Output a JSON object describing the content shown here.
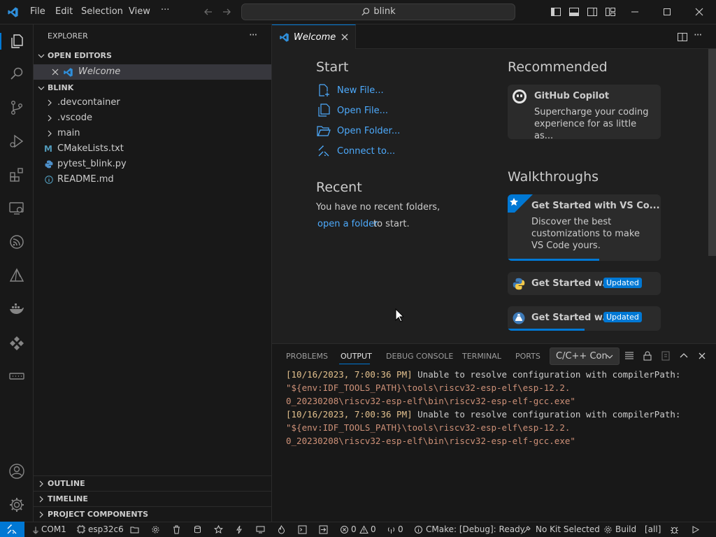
{
  "titlebar": {
    "menus": [
      "File",
      "Edit",
      "Selection",
      "View",
      "···"
    ],
    "search_text": "blink"
  },
  "sidebar": {
    "title": "EXPLORER",
    "open_editors": {
      "label": "OPEN EDITORS",
      "items": [
        {
          "name": "Welcome"
        }
      ]
    },
    "folder": {
      "label": "BLINK",
      "items": [
        {
          "name": ".devcontainer",
          "type": "folder"
        },
        {
          "name": ".vscode",
          "type": "folder"
        },
        {
          "name": "main",
          "type": "folder"
        },
        {
          "name": "CMakeLists.txt",
          "type": "file",
          "icon": "cmake-icon"
        },
        {
          "name": "pytest_blink.py",
          "type": "file",
          "icon": "python-icon"
        },
        {
          "name": "README.md",
          "type": "file",
          "icon": "info-icon"
        }
      ]
    },
    "bottom_sections": [
      "OUTLINE",
      "TIMELINE",
      "PROJECT COMPONENTS"
    ]
  },
  "editor": {
    "tab_label": "Welcome",
    "welcome": {
      "start_heading": "Start",
      "start_items": [
        "New File...",
        "Open File...",
        "Open Folder...",
        "Connect to..."
      ],
      "recent_heading": "Recent",
      "recent_text": "You have no recent folders,",
      "recent_link": "open a folder",
      "recent_suffix": "to start.",
      "recommended_heading": "Recommended",
      "copilot_title": "GitHub Copilot",
      "copilot_desc": "Supercharge your coding experience for as little as...",
      "walkthroughs_heading": "Walkthroughs",
      "walk1_title": "Get Started with VS Co...",
      "walk1_desc": "Discover the best customizations to make VS Code yours.",
      "walk2_title": "Get Started w...",
      "walk3_title": "Get Started w...",
      "updated_badge": "Updated"
    }
  },
  "panel": {
    "tabs": [
      "PROBLEMS",
      "OUTPUT",
      "DEBUG CONSOLE",
      "TERMINAL",
      "PORTS"
    ],
    "active_tab": "OUTPUT",
    "channel": "C/C++ Con",
    "output_lines": [
      {
        "ts": "[10/16/2023, 7:00:36 PM]",
        "msg": " Unable to resolve configuration with compilerPath:",
        "path1": "\"${env:IDF_TOOLS_PATH}\\tools\\riscv32-esp-elf\\esp-12.2.",
        "path2": "0_20230208\\riscv32-esp-elf\\bin\\riscv32-esp-elf-gcc.exe\""
      },
      {
        "ts": "[10/16/2023, 7:00:36 PM]",
        "msg": " Unable to resolve configuration with compilerPath:",
        "path1": "\"${env:IDF_TOOLS_PATH}\\tools\\riscv32-esp-elf\\esp-12.2.",
        "path2": "0_20230208\\riscv32-esp-elf\\bin\\riscv32-esp-elf-gcc.exe\""
      }
    ]
  },
  "statusbar": {
    "port": "COM1",
    "target": "esp32c6",
    "errors": "0",
    "warnings": "0",
    "infos": "0",
    "cmake": "CMake: [Debug]: Ready",
    "kit": "No Kit Selected",
    "build": "Build",
    "all": "[all]"
  },
  "colors": {
    "accent": "#0078d4",
    "link": "#4daafc",
    "timestamp": "#e2c08d",
    "path": "#ce9178",
    "progress": "#0078d4"
  },
  "walkthrough_progress": [
    0.6,
    0,
    0.5
  ]
}
